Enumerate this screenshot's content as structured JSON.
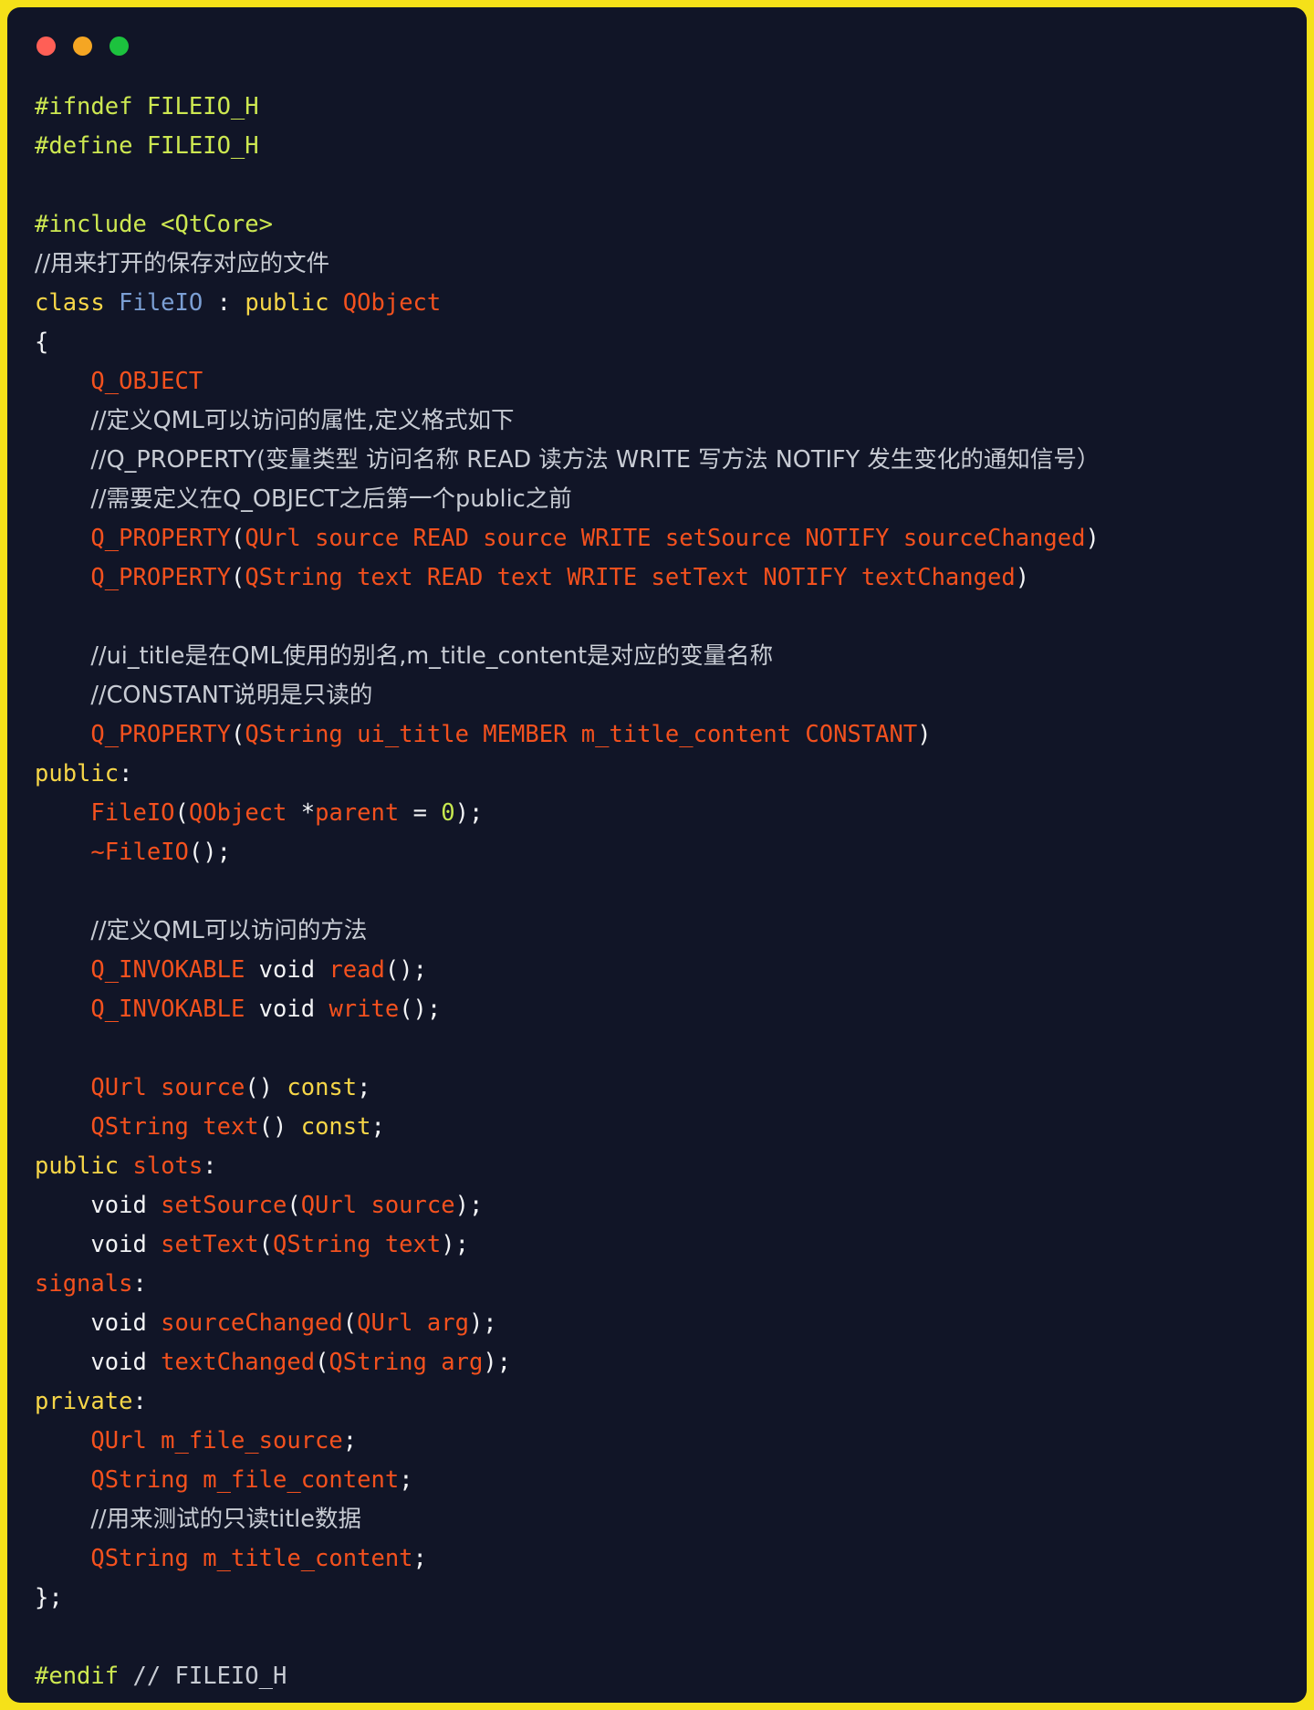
{
  "window": {
    "traffic_lights": [
      {
        "name": "close",
        "color": "#FF5F56"
      },
      {
        "name": "minimize",
        "color": "#F5A623"
      },
      {
        "name": "maximize",
        "color": "#1CC23E"
      }
    ],
    "background": "#111527",
    "border_color": "#F5E119"
  },
  "theme": {
    "preprocessor": "#CDE851",
    "comment": "#C8CCD4",
    "keyword": "#F7D648",
    "identifier": "#F4511E",
    "type": "#7B9FD4",
    "punctuation": "#F2F3F5",
    "number": "#C6E84F"
  },
  "code": {
    "language": "C++ header",
    "lines": [
      {
        "n": 1,
        "tokens": [
          {
            "t": "#ifndef FILEIO_H",
            "c": "pp"
          }
        ]
      },
      {
        "n": 2,
        "tokens": [
          {
            "t": "#define FILEIO_H",
            "c": "pp"
          }
        ]
      },
      {
        "n": 3,
        "tokens": []
      },
      {
        "n": 4,
        "tokens": [
          {
            "t": "#include <QtCore>",
            "c": "pp"
          }
        ]
      },
      {
        "n": 5,
        "tokens": [
          {
            "t": "//用来打开的保存对应的文件",
            "c": "cm"
          }
        ]
      },
      {
        "n": 6,
        "tokens": [
          {
            "t": "class ",
            "c": "kw"
          },
          {
            "t": "FileIO",
            "c": "ty"
          },
          {
            "t": " : ",
            "c": "pn"
          },
          {
            "t": "public ",
            "c": "kw"
          },
          {
            "t": "QObject",
            "c": "id"
          }
        ]
      },
      {
        "n": 7,
        "tokens": [
          {
            "t": "{",
            "c": "pn"
          }
        ]
      },
      {
        "n": 8,
        "tokens": [
          {
            "t": "    ",
            "c": "pn"
          },
          {
            "t": "Q_OBJECT",
            "c": "id"
          }
        ]
      },
      {
        "n": 9,
        "tokens": [
          {
            "t": "    ",
            "c": "pn"
          },
          {
            "t": "//定义QML可以访问的属性,定义格式如下",
            "c": "cm"
          }
        ]
      },
      {
        "n": 10,
        "tokens": [
          {
            "t": "    ",
            "c": "pn"
          },
          {
            "t": "//Q_PROPERTY(变量类型 访问名称 READ 读方法 WRITE 写方法 NOTIFY 发生变化的通知信号）",
            "c": "cm"
          }
        ]
      },
      {
        "n": 11,
        "tokens": [
          {
            "t": "    ",
            "c": "pn"
          },
          {
            "t": "//需要定义在Q_OBJECT之后第一个public之前",
            "c": "cm"
          }
        ]
      },
      {
        "n": 12,
        "tokens": [
          {
            "t": "    ",
            "c": "pn"
          },
          {
            "t": "Q_PROPERTY",
            "c": "id"
          },
          {
            "t": "(",
            "c": "pn"
          },
          {
            "t": "QUrl source READ source WRITE setSource NOTIFY sourceChanged",
            "c": "id"
          },
          {
            "t": ")",
            "c": "pn"
          }
        ]
      },
      {
        "n": 13,
        "tokens": [
          {
            "t": "    ",
            "c": "pn"
          },
          {
            "t": "Q_PROPERTY",
            "c": "id"
          },
          {
            "t": "(",
            "c": "pn"
          },
          {
            "t": "QString text READ text WRITE setText NOTIFY textChanged",
            "c": "id"
          },
          {
            "t": ")",
            "c": "pn"
          }
        ]
      },
      {
        "n": 14,
        "tokens": []
      },
      {
        "n": 15,
        "tokens": [
          {
            "t": "    ",
            "c": "pn"
          },
          {
            "t": "//ui_title是在QML使用的别名,m_title_content是对应的变量名称",
            "c": "cm"
          }
        ]
      },
      {
        "n": 16,
        "tokens": [
          {
            "t": "    ",
            "c": "pn"
          },
          {
            "t": "//CONSTANT说明是只读的",
            "c": "cm"
          }
        ]
      },
      {
        "n": 17,
        "tokens": [
          {
            "t": "    ",
            "c": "pn"
          },
          {
            "t": "Q_PROPERTY",
            "c": "id"
          },
          {
            "t": "(",
            "c": "pn"
          },
          {
            "t": "QString ui_title MEMBER m_title_content CONSTANT",
            "c": "id"
          },
          {
            "t": ")",
            "c": "pn"
          }
        ]
      },
      {
        "n": 18,
        "tokens": [
          {
            "t": "public",
            "c": "kw"
          },
          {
            "t": ":",
            "c": "pn"
          }
        ]
      },
      {
        "n": 19,
        "tokens": [
          {
            "t": "    ",
            "c": "pn"
          },
          {
            "t": "FileIO",
            "c": "id"
          },
          {
            "t": "(",
            "c": "pn"
          },
          {
            "t": "QObject",
            "c": "id"
          },
          {
            "t": " *",
            "c": "pn"
          },
          {
            "t": "parent",
            "c": "id"
          },
          {
            "t": " = ",
            "c": "pn"
          },
          {
            "t": "0",
            "c": "num"
          },
          {
            "t": ");",
            "c": "pn"
          }
        ]
      },
      {
        "n": 20,
        "tokens": [
          {
            "t": "    ",
            "c": "pn"
          },
          {
            "t": "~FileIO",
            "c": "id"
          },
          {
            "t": "();",
            "c": "pn"
          }
        ]
      },
      {
        "n": 21,
        "tokens": []
      },
      {
        "n": 22,
        "tokens": [
          {
            "t": "    ",
            "c": "pn"
          },
          {
            "t": "//定义QML可以访问的方法",
            "c": "cm"
          }
        ]
      },
      {
        "n": 23,
        "tokens": [
          {
            "t": "    ",
            "c": "pn"
          },
          {
            "t": "Q_INVOKABLE",
            "c": "id"
          },
          {
            "t": " void ",
            "c": "pn"
          },
          {
            "t": "read",
            "c": "id"
          },
          {
            "t": "();",
            "c": "pn"
          }
        ]
      },
      {
        "n": 24,
        "tokens": [
          {
            "t": "    ",
            "c": "pn"
          },
          {
            "t": "Q_INVOKABLE",
            "c": "id"
          },
          {
            "t": " void ",
            "c": "pn"
          },
          {
            "t": "write",
            "c": "id"
          },
          {
            "t": "();",
            "c": "pn"
          }
        ]
      },
      {
        "n": 25,
        "tokens": []
      },
      {
        "n": 26,
        "tokens": [
          {
            "t": "    ",
            "c": "pn"
          },
          {
            "t": "QUrl source",
            "c": "id"
          },
          {
            "t": "() ",
            "c": "pn"
          },
          {
            "t": "const",
            "c": "kw"
          },
          {
            "t": ";",
            "c": "pn"
          }
        ]
      },
      {
        "n": 27,
        "tokens": [
          {
            "t": "    ",
            "c": "pn"
          },
          {
            "t": "QString text",
            "c": "id"
          },
          {
            "t": "() ",
            "c": "pn"
          },
          {
            "t": "const",
            "c": "kw"
          },
          {
            "t": ";",
            "c": "pn"
          }
        ]
      },
      {
        "n": 28,
        "tokens": [
          {
            "t": "public",
            "c": "kw"
          },
          {
            "t": " ",
            "c": "pn"
          },
          {
            "t": "slots",
            "c": "id"
          },
          {
            "t": ":",
            "c": "pn"
          }
        ]
      },
      {
        "n": 29,
        "tokens": [
          {
            "t": "    void ",
            "c": "pn"
          },
          {
            "t": "setSource",
            "c": "id"
          },
          {
            "t": "(",
            "c": "pn"
          },
          {
            "t": "QUrl source",
            "c": "id"
          },
          {
            "t": ");",
            "c": "pn"
          }
        ]
      },
      {
        "n": 30,
        "tokens": [
          {
            "t": "    void ",
            "c": "pn"
          },
          {
            "t": "setText",
            "c": "id"
          },
          {
            "t": "(",
            "c": "pn"
          },
          {
            "t": "QString text",
            "c": "id"
          },
          {
            "t": ");",
            "c": "pn"
          }
        ]
      },
      {
        "n": 31,
        "tokens": [
          {
            "t": "signals",
            "c": "id"
          },
          {
            "t": ":",
            "c": "pn"
          }
        ]
      },
      {
        "n": 32,
        "tokens": [
          {
            "t": "    void ",
            "c": "pn"
          },
          {
            "t": "sourceChanged",
            "c": "id"
          },
          {
            "t": "(",
            "c": "pn"
          },
          {
            "t": "QUrl arg",
            "c": "id"
          },
          {
            "t": ");",
            "c": "pn"
          }
        ]
      },
      {
        "n": 33,
        "tokens": [
          {
            "t": "    void ",
            "c": "pn"
          },
          {
            "t": "textChanged",
            "c": "id"
          },
          {
            "t": "(",
            "c": "pn"
          },
          {
            "t": "QString arg",
            "c": "id"
          },
          {
            "t": ");",
            "c": "pn"
          }
        ]
      },
      {
        "n": 34,
        "tokens": [
          {
            "t": "private",
            "c": "kw"
          },
          {
            "t": ":",
            "c": "pn"
          }
        ]
      },
      {
        "n": 35,
        "tokens": [
          {
            "t": "    ",
            "c": "pn"
          },
          {
            "t": "QUrl m_file_source",
            "c": "id"
          },
          {
            "t": ";",
            "c": "pn"
          }
        ]
      },
      {
        "n": 36,
        "tokens": [
          {
            "t": "    ",
            "c": "pn"
          },
          {
            "t": "QString m_file_content",
            "c": "id"
          },
          {
            "t": ";",
            "c": "pn"
          }
        ]
      },
      {
        "n": 37,
        "tokens": [
          {
            "t": "    ",
            "c": "pn"
          },
          {
            "t": "//用来测试的只读title数据",
            "c": "cm"
          }
        ]
      },
      {
        "n": 38,
        "tokens": [
          {
            "t": "    ",
            "c": "pn"
          },
          {
            "t": "QString m_title_content",
            "c": "id"
          },
          {
            "t": ";",
            "c": "pn"
          }
        ]
      },
      {
        "n": 39,
        "tokens": [
          {
            "t": "};",
            "c": "pn"
          }
        ]
      },
      {
        "n": 40,
        "tokens": []
      },
      {
        "n": 41,
        "tokens": [
          {
            "t": "#endif ",
            "c": "pp"
          },
          {
            "t": "// FILEIO_H",
            "c": "cmm"
          }
        ]
      }
    ]
  }
}
